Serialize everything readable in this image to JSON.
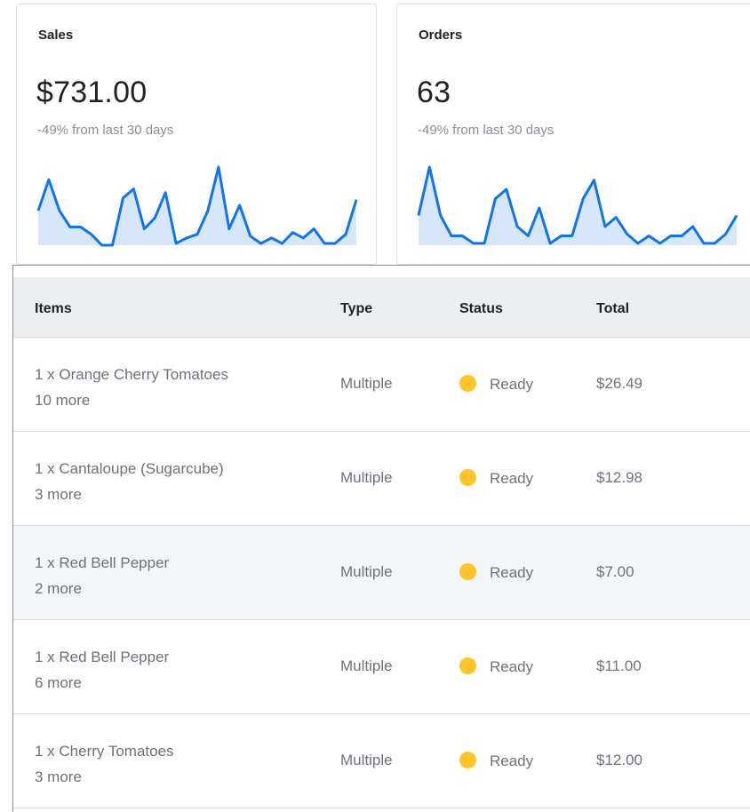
{
  "colors": {
    "accent": "#1273eb",
    "spark_fill": "#d7e7fb",
    "status_ready": "#ffc32b"
  },
  "cards": [
    {
      "title": "Sales",
      "value": "$731.00",
      "subtitle": "-49% from last 30 days",
      "sparkline": [
        38,
        72,
        38,
        20,
        20,
        12,
        0,
        0,
        52,
        62,
        18,
        30,
        58,
        2,
        8,
        12,
        38,
        86,
        18,
        44,
        10,
        2,
        8,
        2,
        14,
        8,
        18,
        2,
        2,
        12,
        50
      ]
    },
    {
      "title": "Orders",
      "value": "63",
      "subtitle": "-49% from last 30 days",
      "sparkline": [
        32,
        84,
        32,
        10,
        10,
        2,
        2,
        50,
        60,
        20,
        10,
        40,
        2,
        10,
        10,
        50,
        70,
        20,
        30,
        12,
        2,
        10,
        2,
        10,
        10,
        20,
        2,
        2,
        12,
        32
      ]
    }
  ],
  "table": {
    "headers": [
      "Items",
      "Type",
      "Status",
      "Total"
    ],
    "rows": [
      {
        "item": "1 x Orange Cherry Tomatoes",
        "more": "10 more",
        "type": "Multiple",
        "status": "Ready",
        "total": "$26.49"
      },
      {
        "item": "1 x Cantaloupe (Sugarcube)",
        "more": "3 more",
        "type": "Multiple",
        "status": "Ready",
        "total": "$12.98"
      },
      {
        "item": "1 x Red Bell Pepper",
        "more": "2 more",
        "type": "Multiple",
        "status": "Ready",
        "total": "$7.00"
      },
      {
        "item": "1 x Red Bell Pepper",
        "more": "6 more",
        "type": "Multiple",
        "status": "Ready",
        "total": "$11.00"
      },
      {
        "item": "1 x Cherry Tomatoes",
        "more": "3 more",
        "type": "Multiple",
        "status": "Ready",
        "total": "$12.00"
      }
    ]
  }
}
